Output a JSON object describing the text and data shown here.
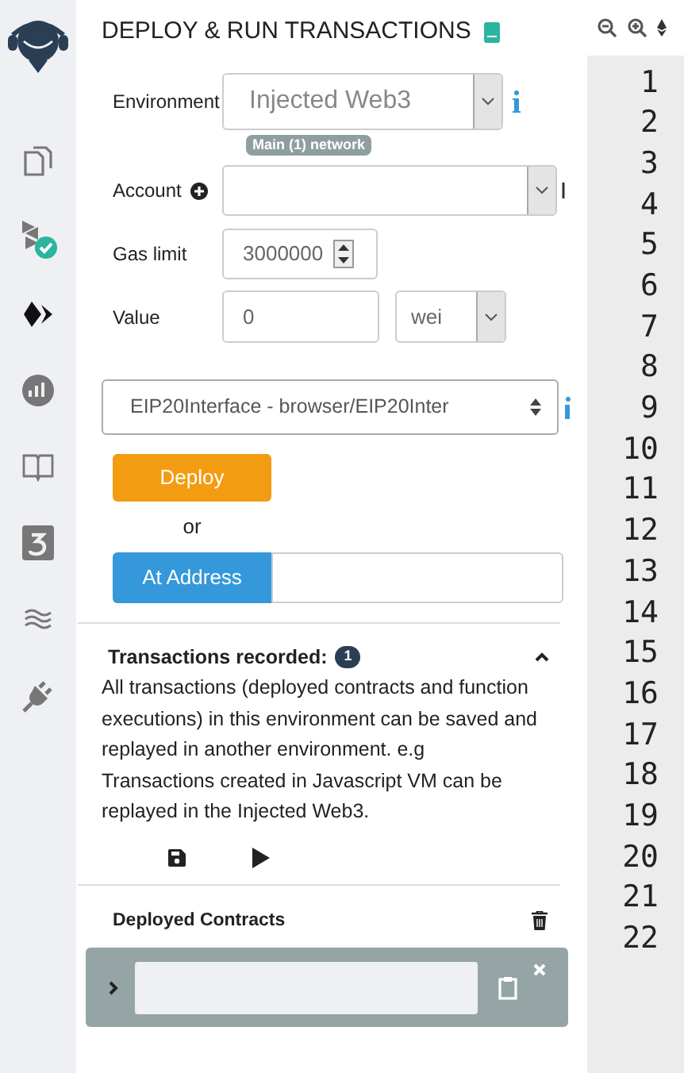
{
  "sidebar": {
    "items": [
      {
        "kind": "files",
        "selected": false
      },
      {
        "kind": "compiler",
        "selected": false
      },
      {
        "kind": "deploy",
        "selected": true
      },
      {
        "kind": "analysis",
        "selected": false
      },
      {
        "kind": "docs",
        "selected": false
      },
      {
        "kind": "three",
        "selected": false
      },
      {
        "kind": "debugger",
        "selected": false
      },
      {
        "kind": "plugin",
        "selected": false
      }
    ]
  },
  "panel": {
    "title": "DEPLOY & RUN TRANSACTIONS",
    "environment": {
      "label": "Environment",
      "value": "Injected Web3",
      "network": "Main (1) network"
    },
    "account": {
      "label": "Account"
    },
    "gas_limit": {
      "label": "Gas limit",
      "value": "3000000"
    },
    "value": {
      "label": "Value",
      "value": "0",
      "unit": "wei"
    },
    "contract": {
      "value": "EIP20Interface - browser/EIP20Inter"
    },
    "deploy_button": "Deploy",
    "or": "or",
    "at_address_button": "At Address",
    "transactions": {
      "title": "Transactions recorded:",
      "count": "1",
      "expanded": true,
      "description": "All transactions (deployed contracts and function executions) in this environment can be saved and replayed in another environment. e.g Transactions created in Javascript VM can be replayed in the Injected Web3."
    },
    "deployed": {
      "title": "Deployed Contracts",
      "instances": [
        {
          "expanded": false
        }
      ]
    }
  },
  "editor": {
    "line_numbers": [
      "1",
      "2",
      "3",
      "4",
      "5",
      "6",
      "7",
      "8",
      "9",
      "10",
      "11",
      "12",
      "13",
      "14",
      "15",
      "16",
      "17",
      "18",
      "19",
      "20",
      "21",
      "22"
    ]
  }
}
